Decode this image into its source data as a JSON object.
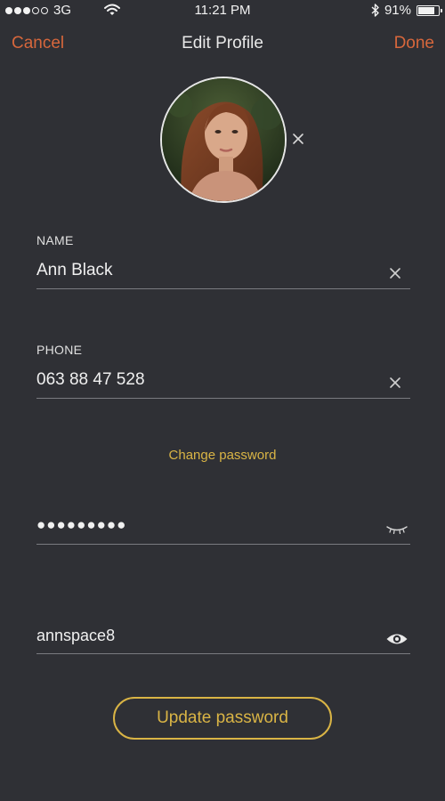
{
  "status_bar": {
    "carrier": "3G",
    "time": "11:21 PM",
    "battery": "91%",
    "battery_level": 0.91,
    "signal_bars_on": 3,
    "signal_bars_total": 5,
    "icons": [
      "signal-dots-icon",
      "wifi-icon",
      "bluetooth-icon",
      "battery-icon"
    ]
  },
  "nav": {
    "cancel": "Cancel",
    "title": "Edit Profile",
    "done": "Done"
  },
  "avatar": {
    "remove_icon": "close-icon"
  },
  "fields": {
    "name": {
      "label": "NAME",
      "value": "Ann Black",
      "clear_icon": "close-icon"
    },
    "phone": {
      "label": "PHONE",
      "value": "063 88 47 528",
      "clear_icon": "close-icon"
    }
  },
  "password": {
    "change_link": "Change password",
    "masked_value": "●●●●●●●●●",
    "masked_icon": "eye-closed-icon",
    "plain_value": "annspace8",
    "plain_icon": "eye-open-icon"
  },
  "update_button": "Update password",
  "colors": {
    "background": "#2f3035",
    "accent_orange": "#d7673c",
    "accent_gold": "#d9b445",
    "text": "#f0f0f0",
    "divider": "#7a7b80"
  }
}
